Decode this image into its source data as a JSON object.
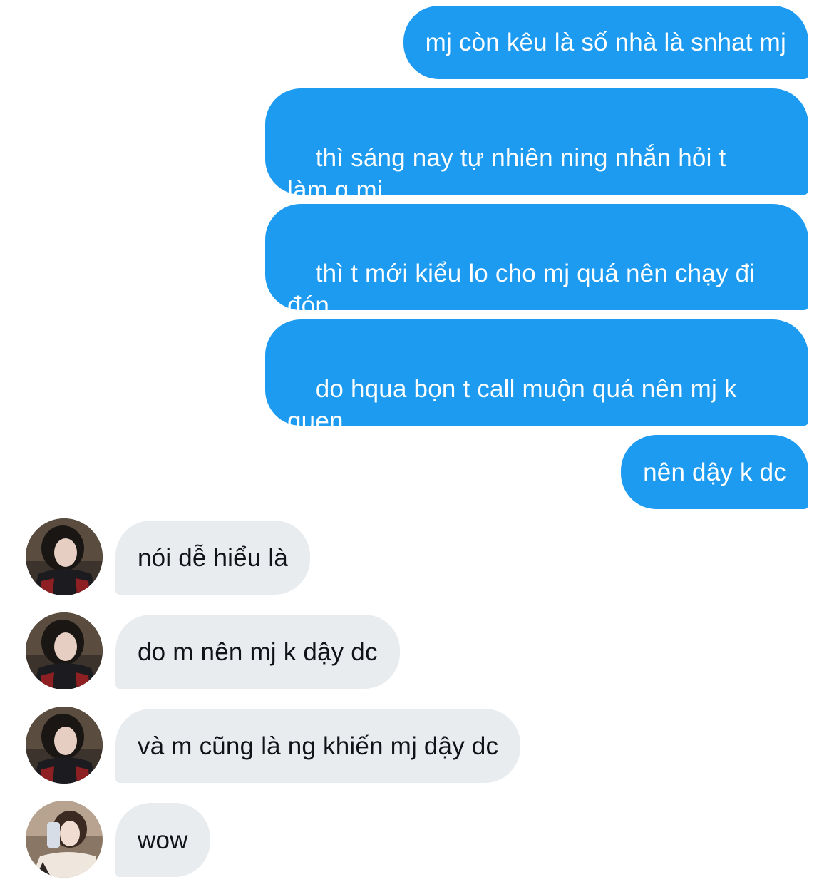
{
  "conversation": {
    "messages": [
      {
        "direction": "outgoing",
        "text": "mj còn kêu là số nhà là snhat mj"
      },
      {
        "direction": "outgoing",
        "text": "thì sáng nay tự nhiên ning nhắn hỏi t\nlàm g mj"
      },
      {
        "direction": "outgoing",
        "text": "thì t mới kiểu lo cho mj quá nên chạy đi\nđón"
      },
      {
        "direction": "outgoing",
        "text": "do hqua bọn t call muộn quá nên mj k\nquen"
      },
      {
        "direction": "outgoing",
        "text": "nên dậy k dc"
      },
      {
        "direction": "incoming",
        "text": "nói dễ hiểu là",
        "avatar": "avatar-user-1"
      },
      {
        "direction": "incoming",
        "text": "do m nên mj k dậy dc",
        "avatar": "avatar-user-1"
      },
      {
        "direction": "incoming",
        "text": "và m cũng là ng khiến mj dậy dc",
        "avatar": "avatar-user-1"
      },
      {
        "direction": "incoming",
        "text": "wow",
        "avatar": "avatar-user-2"
      }
    ]
  },
  "colors": {
    "outgoing_bubble": "#1d9bf0",
    "outgoing_text": "#ffffff",
    "incoming_bubble": "#e8ecef",
    "incoming_text": "#101418"
  }
}
